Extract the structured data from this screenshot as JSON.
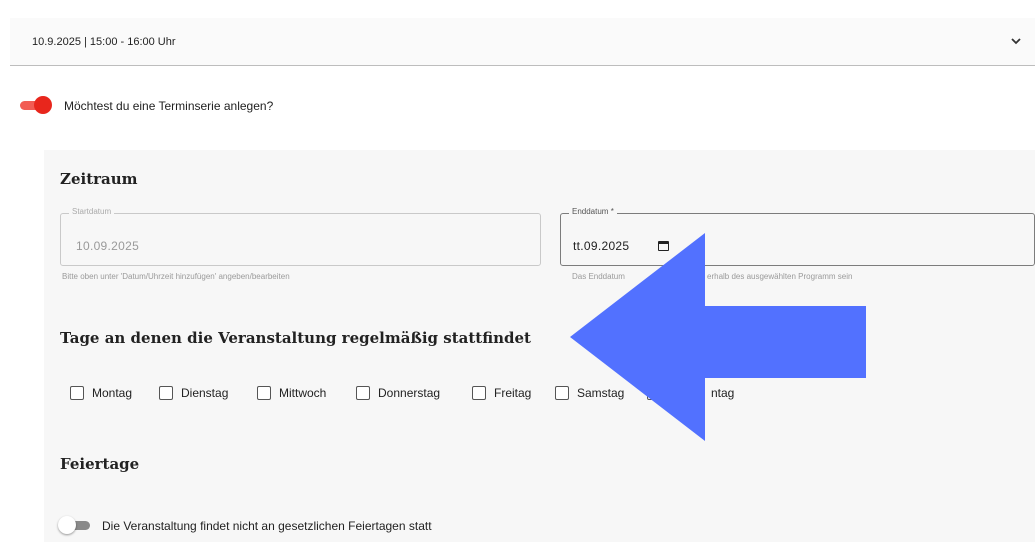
{
  "date_select": {
    "value": "10.9.2025 | 15:00 - 16:00 Uhr",
    "chevron_icon": "chevron-down-icon"
  },
  "series_toggle": {
    "label": "Möchtest du eine Terminserie anlegen?",
    "on": true,
    "color": "#e8261c"
  },
  "zeitraum": {
    "heading": "Zeitraum",
    "start": {
      "legend": "Startdatum",
      "value": "10.09.2025",
      "hint": "Bitte oben unter 'Datum/Uhrzeit hinzufügen' angeben/bearbeiten"
    },
    "end": {
      "legend": "Enddatum *",
      "value": "tt.09.2025",
      "icon": "calendar-icon",
      "hint_start": "Das Enddatum",
      "hint_end": "erhalb des ausgewählten Programm sein"
    }
  },
  "weekdays": {
    "heading": "Tage an denen die Veranstaltung regelmäßig stattfindet",
    "items": [
      "Montag",
      "Dienstag",
      "Mittwoch",
      "Donnerstag",
      "Freitag",
      "Samstag",
      "ntag"
    ]
  },
  "holidays": {
    "heading": "Feiertage",
    "toggle_label": "Die Veranstaltung findet nicht an gesetzlichen Feiertagen statt",
    "on": false
  },
  "overlay": {
    "icon": "left-arrow-overlay",
    "color": "#5271ff"
  }
}
